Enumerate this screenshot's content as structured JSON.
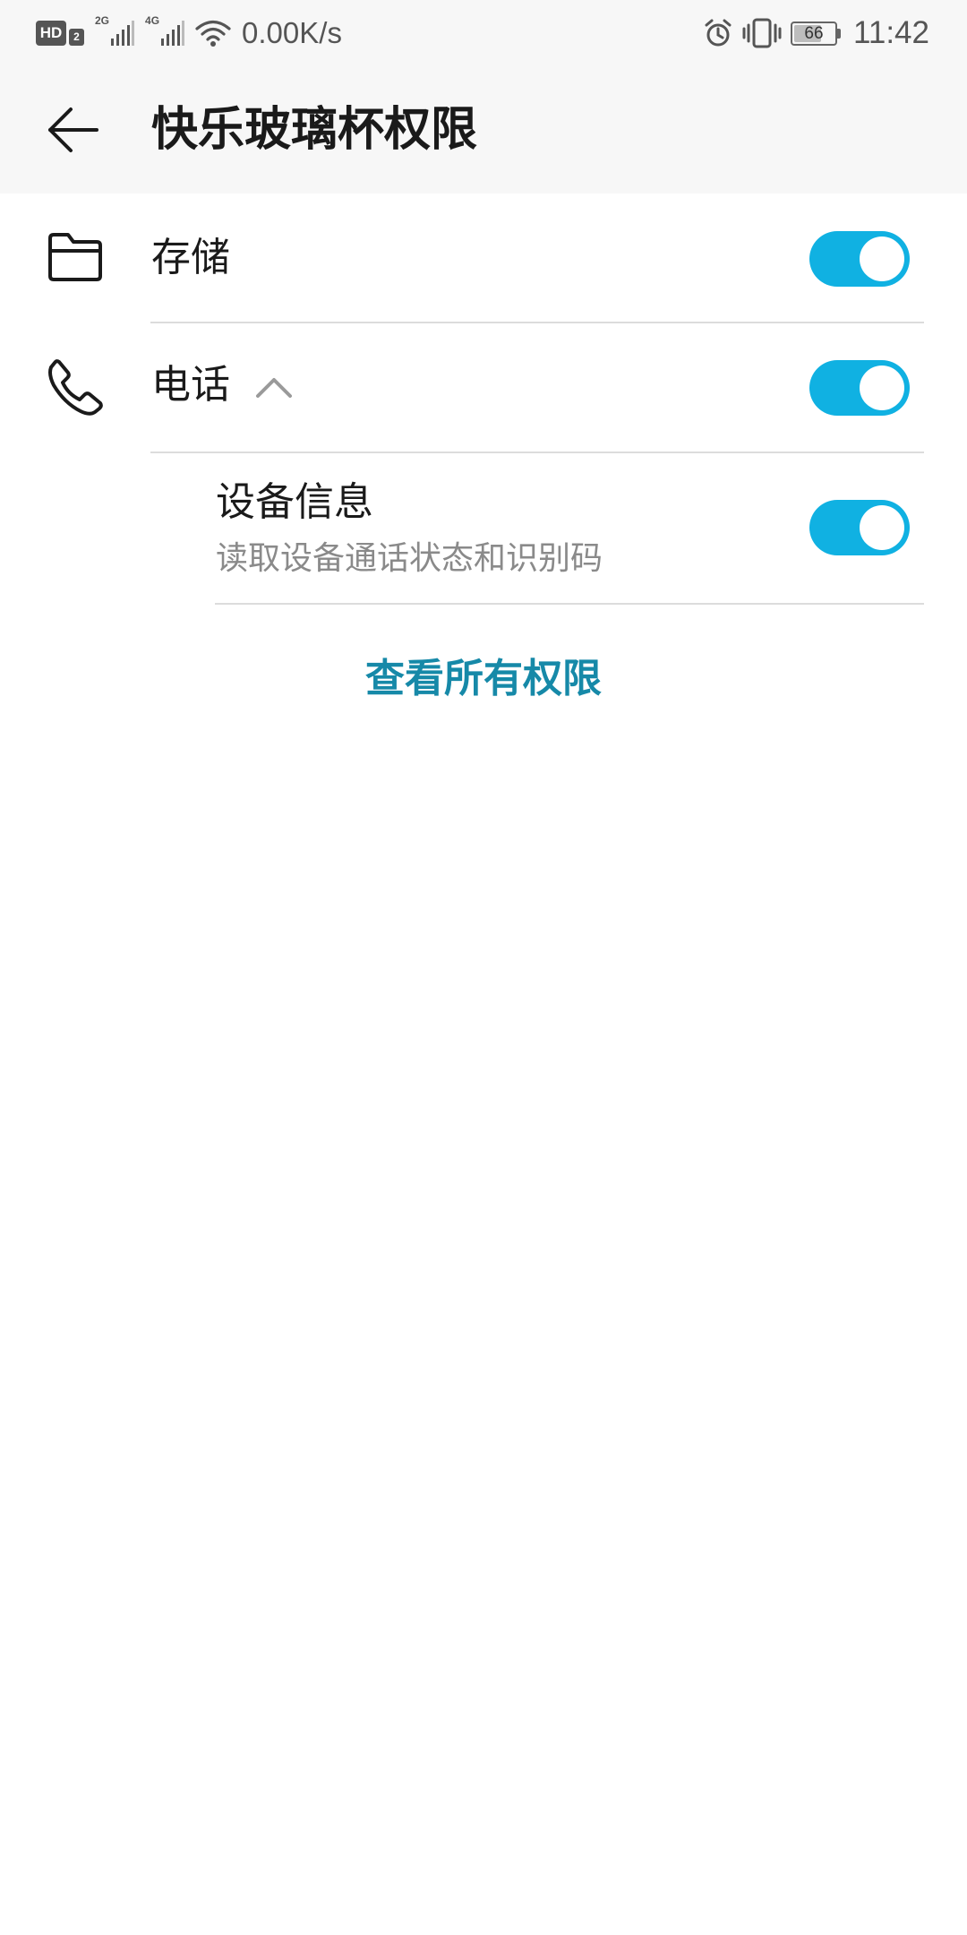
{
  "status_bar": {
    "hd_label": "HD",
    "hd_sub": "2",
    "net1": "2G",
    "net2": "4G",
    "speed": "0.00K/s",
    "battery": "66",
    "time": "11:42"
  },
  "app_bar": {
    "title": "快乐玻璃杯权限"
  },
  "permissions": [
    {
      "label": "存储",
      "icon": "folder-icon",
      "enabled": true
    },
    {
      "label": "电话",
      "icon": "phone-icon",
      "enabled": true,
      "expanded": true,
      "children": [
        {
          "title": "设备信息",
          "description": "读取设备通话状态和识别码",
          "enabled": true
        }
      ]
    }
  ],
  "see_all_link": "查看所有权限",
  "colors": {
    "toggle_on": "#10b1e2",
    "link": "#1689a8"
  }
}
